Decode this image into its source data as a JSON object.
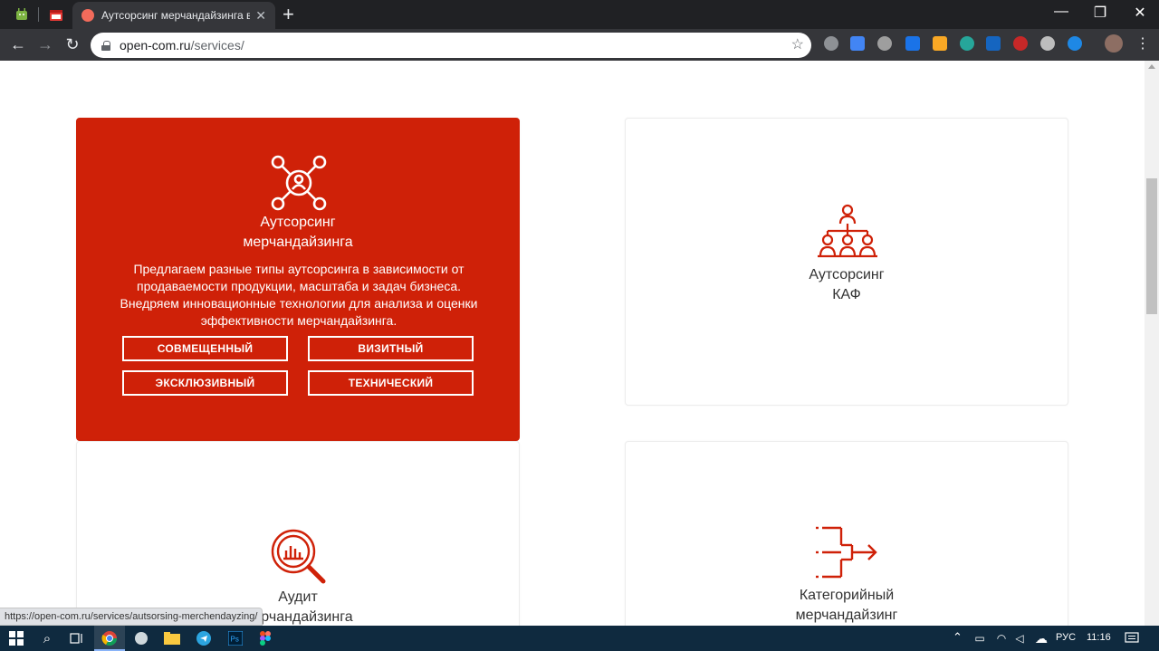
{
  "browser": {
    "tab_title": "Аутсорсинг мерчандайзинга в М",
    "new_tab_symbol": "+",
    "url_host": "open-com.ru",
    "url_path": "/services/",
    "window_controls": {
      "minimize": "—",
      "restore": "❐",
      "close": "✕"
    },
    "nav": {
      "back": "←",
      "forward": "→",
      "reload": "↻"
    }
  },
  "cards": {
    "outsourcing": {
      "title_line1": "Аутсорсинг",
      "title_line2": "мерчандайзинга",
      "description": "Предлагаем разные типы аутсорсинга в зависимости от продаваемости продукции, масштаба и задач бизнеса. Внедряем инновационные технологии для анализа и оценки эффективности мерчандайзинга.",
      "buttons": [
        "СОВМЕЩЕННЫЙ",
        "ВИЗИТНЫЙ",
        "ЭКСКЛЮЗИВНЫЙ",
        "ТЕХНИЧЕСКИЙ"
      ]
    },
    "kaf": {
      "title_line1": "Аутсорсинг",
      "title_line2": "КАФ"
    },
    "audit": {
      "title_line1": "Аудит",
      "title_line2": "мерчандайзинга"
    },
    "category": {
      "title_line1": "Категорийный",
      "title_line2": "мерчандайзинг"
    }
  },
  "status_link": "https://open-com.ru/services/autsorsing-merchendayzing/",
  "taskbar": {
    "language": "РУС",
    "time": "11:16"
  },
  "colors": {
    "accent_red": "#cf2108",
    "chrome_dark": "#202124",
    "taskbar": "#0f2a3f"
  }
}
